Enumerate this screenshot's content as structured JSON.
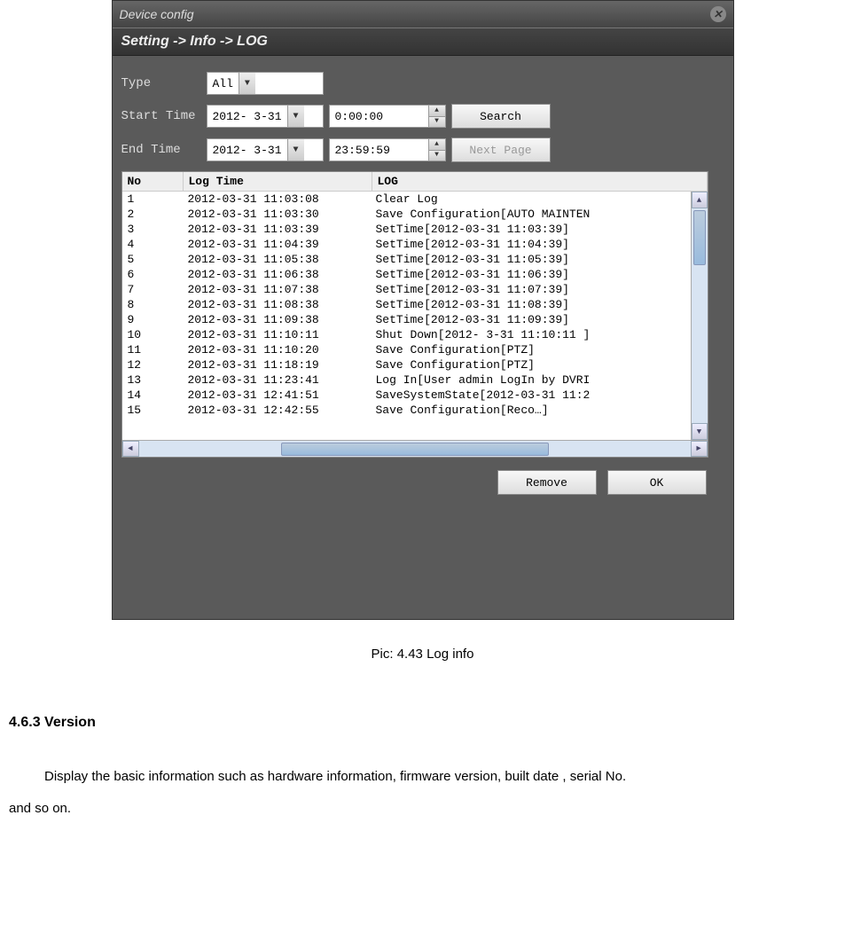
{
  "window": {
    "title": "Device config"
  },
  "breadcrumb": "Setting -> Info -> LOG",
  "form": {
    "type_label": "Type",
    "type_value": "All",
    "start_label": "Start Time",
    "start_date": "2012- 3-31",
    "start_time": "0:00:00",
    "end_label": "End Time",
    "end_date": "2012- 3-31",
    "end_time": "23:59:59",
    "search_btn": "Search",
    "next_btn": "Next Page"
  },
  "table": {
    "headers": {
      "no": "No",
      "time": "Log Time",
      "log": "LOG"
    },
    "rows": [
      {
        "no": "1",
        "time": "2012-03-31 11:03:08",
        "log": "Clear Log"
      },
      {
        "no": "2",
        "time": "2012-03-31 11:03:30",
        "log": "Save Configuration[AUTO MAINTEN"
      },
      {
        "no": "3",
        "time": "2012-03-31 11:03:39",
        "log": "SetTime[2012-03-31 11:03:39]"
      },
      {
        "no": "4",
        "time": "2012-03-31 11:04:39",
        "log": "SetTime[2012-03-31 11:04:39]"
      },
      {
        "no": "5",
        "time": "2012-03-31 11:05:38",
        "log": "SetTime[2012-03-31 11:05:39]"
      },
      {
        "no": "6",
        "time": "2012-03-31 11:06:38",
        "log": "SetTime[2012-03-31 11:06:39]"
      },
      {
        "no": "7",
        "time": "2012-03-31 11:07:38",
        "log": "SetTime[2012-03-31 11:07:39]"
      },
      {
        "no": "8",
        "time": "2012-03-31 11:08:38",
        "log": "SetTime[2012-03-31 11:08:39]"
      },
      {
        "no": "9",
        "time": "2012-03-31 11:09:38",
        "log": "SetTime[2012-03-31 11:09:39]"
      },
      {
        "no": "10",
        "time": "2012-03-31 11:10:11",
        "log": "Shut Down[2012- 3-31 11:10:11 ]"
      },
      {
        "no": "11",
        "time": "2012-03-31 11:10:20",
        "log": "Save Configuration[PTZ]"
      },
      {
        "no": "12",
        "time": "2012-03-31 11:18:19",
        "log": "Save Configuration[PTZ]"
      },
      {
        "no": "13",
        "time": "2012-03-31 11:23:41",
        "log": "Log In[User admin LogIn by DVRI"
      },
      {
        "no": "14",
        "time": "2012-03-31 12:41:51",
        "log": "SaveSystemState[2012-03-31 11:2"
      },
      {
        "no": "15",
        "time": "2012-03-31 12:42:55",
        "log": "Save Configuration[Reco…]"
      }
    ]
  },
  "footer": {
    "remove": "Remove",
    "ok": "OK"
  },
  "caption": "Pic: 4.43 Log info",
  "section": {
    "heading": "4.6.3 Version",
    "line1": "Display the basic information such as hardware information, firmware version, built date , serial No.",
    "line2": "and so on."
  }
}
